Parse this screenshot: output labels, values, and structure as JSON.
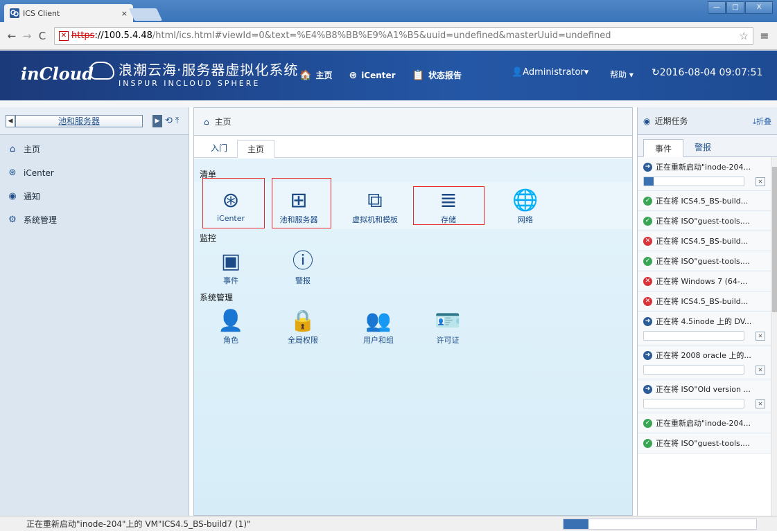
{
  "browser": {
    "tab_title": "ICS Client",
    "tab_close": "×",
    "url_scheme": "https",
    "url_host": "://100.5.4.48",
    "url_path": "/html/ics.html#viewId=0&text=%E4%B8%BB%E9%A1%B5&uuid=undefined&masterUuid=undefined",
    "back": "←",
    "forward": "→",
    "reload": "C",
    "star": "☆",
    "menu": "≡",
    "win_min": "—",
    "win_max": "□",
    "win_close": "X"
  },
  "header": {
    "logo_word": "inCloud",
    "logo_cn": "浪潮云海·服务器虚拟化系统",
    "logo_en": "INSPUR INCLOUD SPHERE",
    "nav": [
      {
        "icon": "home-icon",
        "glyph": "🏠",
        "label": "主页"
      },
      {
        "icon": "icenter-icon",
        "glyph": "⊛",
        "label": "iCenter"
      },
      {
        "icon": "report-icon",
        "glyph": "📋",
        "label": "状态报告"
      }
    ],
    "user": "👤Administrator▾",
    "help": "帮助 ▾",
    "clock": "↻2016-08-04 09:07:51"
  },
  "left": {
    "back": "◀",
    "crumb": "池和服务器",
    "fwd": "▶",
    "history": "⟲",
    "pin": "⤒",
    "items": [
      {
        "icon": "home-icon",
        "glyph": "⌂",
        "label": "主页"
      },
      {
        "icon": "icenter-icon",
        "glyph": "⊛",
        "label": "iCenter"
      },
      {
        "icon": "notice-icon",
        "glyph": "◉",
        "label": "通知"
      },
      {
        "icon": "gear-icon",
        "glyph": "⚙",
        "label": "系统管理"
      }
    ]
  },
  "center": {
    "head": "主页",
    "tabs": [
      "入门",
      "主页"
    ],
    "sections": [
      {
        "title": "清单",
        "items": [
          {
            "icon": "icenter-icon",
            "glyph": "⊛",
            "label": "iCenter"
          },
          {
            "icon": "server-tree-icon",
            "glyph": "⊞",
            "label": "池和服务器"
          },
          {
            "icon": "vm-template-icon",
            "glyph": "⧉",
            "label": "虚拟机和模板"
          },
          {
            "icon": "storage-icon",
            "glyph": "≣",
            "label": "存储"
          },
          {
            "icon": "globe-icon",
            "glyph": "🌐",
            "label": "网络"
          }
        ]
      },
      {
        "title": "监控",
        "items": [
          {
            "icon": "event-icon",
            "glyph": "▣",
            "label": "事件"
          },
          {
            "icon": "alarm-icon",
            "glyph": "ⓘ",
            "label": "警报"
          }
        ]
      },
      {
        "title": "系统管理",
        "items": [
          {
            "icon": "role-icon",
            "glyph": "👤",
            "label": "角色"
          },
          {
            "icon": "permission-icon",
            "glyph": "🔒",
            "label": "全局权限"
          },
          {
            "icon": "users-groups-icon",
            "glyph": "👥",
            "label": "用户和组"
          },
          {
            "icon": "license-icon",
            "glyph": "🪪",
            "label": "许可证"
          }
        ]
      }
    ]
  },
  "right": {
    "title": "近期任务",
    "collapse": "⤓折叠",
    "tabs": [
      "事件",
      "警报"
    ],
    "tasks": [
      {
        "status": "run",
        "text": "正在重新启动\"inode-204...",
        "progress": 0.1
      },
      {
        "status": "ok",
        "text": "正在将 ICS4.5_BS-build..."
      },
      {
        "status": "ok",
        "text": "正在将 ISO\"guest-tools...."
      },
      {
        "status": "err",
        "text": "正在将 ICS4.5_BS-build..."
      },
      {
        "status": "ok",
        "text": "正在将 ISO\"guest-tools...."
      },
      {
        "status": "err",
        "text": "正在将 Windows 7 (64-..."
      },
      {
        "status": "err",
        "text": "正在将 ICS4.5_BS-build..."
      },
      {
        "status": "run",
        "text": "正在将 4.5inode 上的 DV...",
        "progress": 0.0
      },
      {
        "status": "run",
        "text": "正在将 2008 oracle 上的...",
        "progress": 0.0
      },
      {
        "status": "run",
        "text": "正在将 ISO\"Old version ...",
        "progress": 0.0
      },
      {
        "status": "ok",
        "text": "正在重新启动\"inode-204..."
      },
      {
        "status": "ok",
        "text": "正在将 ISO\"guest-tools...."
      }
    ]
  },
  "status": {
    "text": "正在重新启动\"inode-204\"上的 VM\"ICS4.5_BS-build7 (1)\"",
    "progress": 0.13
  }
}
